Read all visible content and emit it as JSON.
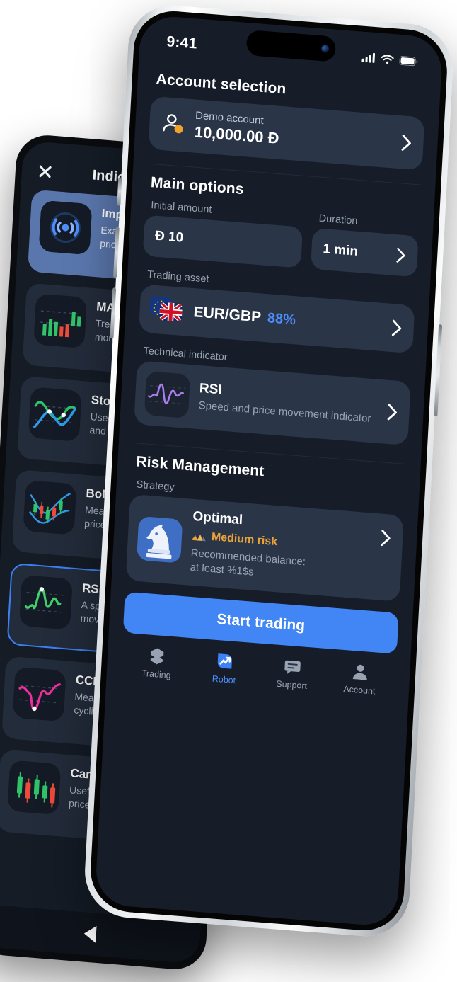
{
  "theme": {
    "accent": "#4285f4",
    "accent_text": "#4e8df8",
    "bg": "#161d28",
    "card": "#2b3548",
    "risk_orange": "#e9a13b",
    "muted_text": "#99a3b3"
  },
  "front_phone": {
    "status_bar": {
      "time": "9:41",
      "cellular": "signal-bars-icon",
      "wifi": "wifi-icon",
      "battery": "battery-icon"
    },
    "account": {
      "section_title": "Account selection",
      "chevron": "chevron-right-icon",
      "avatar_icon": "user-avatar-icon",
      "type": "Demo account",
      "balance": "10,000.00 Ð"
    },
    "main_options": {
      "section_title": "Main options",
      "initial_amount": {
        "label": "Initial amount",
        "value": "Ð 10"
      },
      "duration": {
        "label": "Duration",
        "value": "1 min",
        "chevron": "chevron-right-icon"
      },
      "trading_asset": {
        "label": "Trading asset",
        "chevron": "chevron-right-icon",
        "flag_left": "eu-flag-icon",
        "flag_right": "gb-flag-icon",
        "pair": "EUR/GBP",
        "payout": "88%"
      },
      "technical_indicator": {
        "label": "Technical indicator",
        "chevron": "chevron-right-icon",
        "thumb": "rsi-chart-icon",
        "name": "RSI",
        "desc": "Speed and price movement indicator"
      }
    },
    "risk_management": {
      "section_title": "Risk Management",
      "strategy": {
        "label": "Strategy",
        "chevron": "chevron-right-icon",
        "thumb": "chess-knight-icon",
        "name": "Optimal",
        "risk_icon": "risk-gauge-icon",
        "risk_level": "Medium risk",
        "recommended_line1": "Recommended balance:",
        "recommended_line2": "at least %1$s"
      }
    },
    "cta": {
      "label": "Start trading"
    },
    "tabs": [
      {
        "label": "Trading",
        "icon": "trading-hexagon-icon",
        "active": false
      },
      {
        "label": "Robot",
        "icon": "robot-arrow-icon",
        "active": true
      },
      {
        "label": "Support",
        "icon": "chat-bubble-icon",
        "active": false
      },
      {
        "label": "Account",
        "icon": "person-icon",
        "active": false
      }
    ]
  },
  "back_phone": {
    "close_icon": "close-icon",
    "title": "Indicators",
    "items": [
      {
        "name": "Impulse",
        "desc": "Exact entry signals by price acceleration",
        "thumb": "pulse-radar-icon",
        "state": "selected"
      },
      {
        "name": "MACD",
        "desc": "Trend strength and momentum shifts",
        "thumb": "macd-bars-icon",
        "state": "normal"
      },
      {
        "name": "Stochastic",
        "desc": "Used to spot overbought and oversold trend zones",
        "thumb": "stochastic-lines-icon",
        "state": "normal"
      },
      {
        "name": "Bollinger Bands",
        "desc": "Measures volatility and price channels",
        "thumb": "bollinger-candles-icon",
        "state": "normal"
      },
      {
        "name": "RSI",
        "desc": "A speed and price movement indicator",
        "thumb": "rsi-green-icon",
        "state": "outlined"
      },
      {
        "name": "CCI",
        "desc": "Measures deviation from cyclical average",
        "thumb": "cci-pink-icon",
        "state": "normal"
      },
      {
        "name": "Candles",
        "desc": "Useful for reading raw price trends",
        "thumb": "candles-icon",
        "state": "normal"
      }
    ],
    "nav_back_icon": "android-back-icon"
  }
}
